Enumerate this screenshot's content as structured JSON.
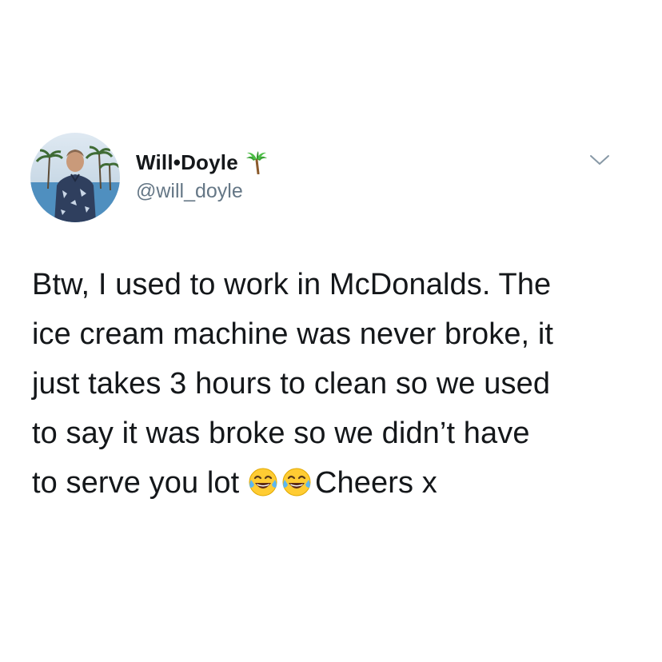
{
  "author": {
    "display_name": "Will•Doyle",
    "handle": "@will_doyle",
    "name_badge_icon": "palm-tree-icon"
  },
  "tweet": {
    "lines": [
      "Btw, I used to work in McDonalds. The",
      "ice cream machine was never broke, it",
      "just takes 3 hours to clean so we used",
      "to say it was broke so we didn’t have",
      "to serve you lot "
    ],
    "emoji": [
      "face-with-tears-of-joy-icon",
      "face-with-tears-of-joy-icon"
    ],
    "closing_text": "Cheers x"
  },
  "menu": {
    "icon": "chevron-down-icon"
  },
  "colors": {
    "text_primary": "#14171a",
    "text_secondary": "#657786",
    "background": "#ffffff",
    "caret": "#8899a6"
  }
}
